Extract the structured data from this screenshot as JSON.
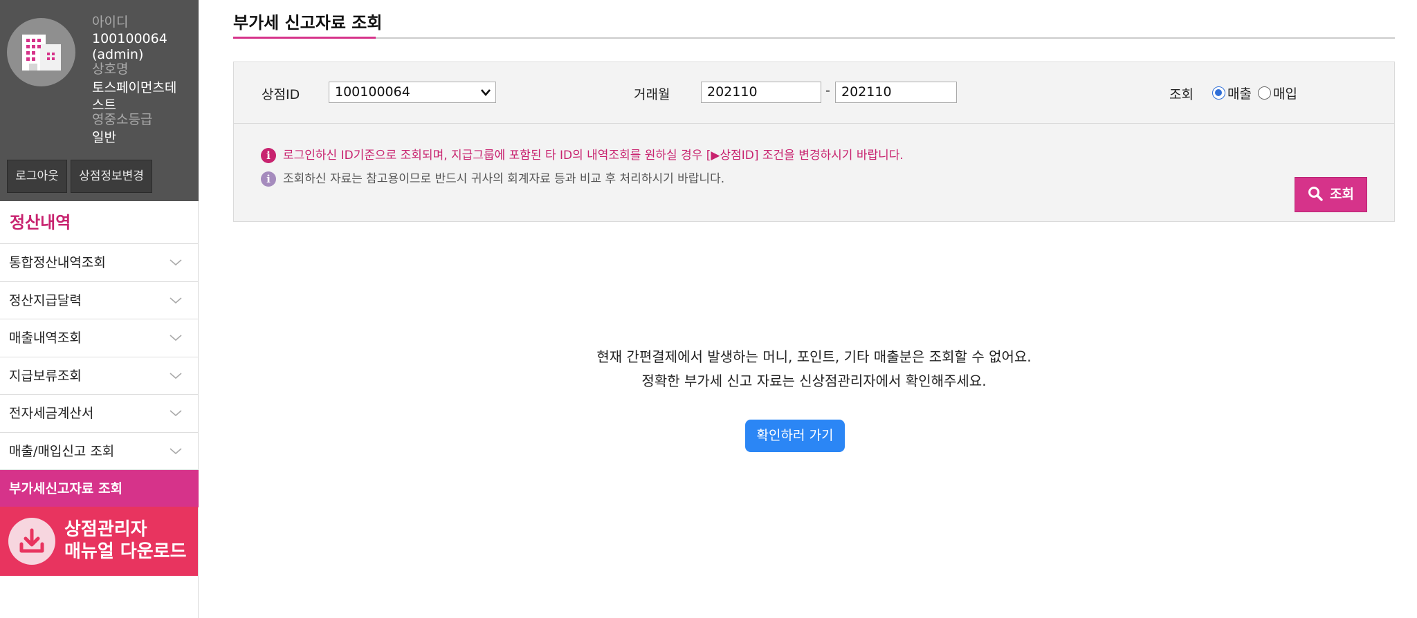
{
  "profile": {
    "id_label": "아이디",
    "id_value": "100100064",
    "id_role": "(admin)",
    "store_name_label": "상호명",
    "store_name_line1": "토스페이먼츠테",
    "store_name_line2": "스트",
    "grade_label": "영중소등급",
    "grade_value": "일반",
    "avatar_icon": "building-icon",
    "logout_label": "로그아웃",
    "edit_label": "상점정보변경"
  },
  "sidebar": {
    "section_title": "정산내역",
    "items": [
      {
        "label": "통합정산내역조회",
        "icon": "chevron-down-icon"
      },
      {
        "label": "정산지급달력",
        "icon": "chevron-down-icon"
      },
      {
        "label": "매출내역조회",
        "icon": "chevron-down-icon"
      },
      {
        "label": "지급보류조회",
        "icon": "chevron-down-icon"
      },
      {
        "label": "전자세금계산서",
        "icon": "chevron-down-icon"
      },
      {
        "label": "매출/매입신고 조회",
        "icon": "chevron-down-icon"
      },
      {
        "label": "부가세신고자료 조회",
        "active": true
      }
    ],
    "manual_banner": {
      "line1": "상점관리자",
      "line2": "매뉴얼 다운로드",
      "icon": "download-icon",
      "color": "#e8345f"
    }
  },
  "main": {
    "title": "부가세 신고자료 조회",
    "filters": {
      "store_id_label": "상점ID",
      "store_id_value": "100100064",
      "period_label": "거래월",
      "period_from": "202110",
      "period_separator": "-",
      "period_to": "202110",
      "view_label": "조회",
      "radio_options": [
        {
          "label": "매출",
          "selected": true
        },
        {
          "label": "매입",
          "selected": false
        }
      ]
    },
    "notices": [
      "로그인하신 ID기준으로 조회되며, 지급그룹에 포함된 타 ID의 내역조회를 원하실 경우 [▶상점ID] 조건을 변경하시기 바랍니다.",
      "조회하신 자료는 참고용이므로 반드시 귀사의 회계자료 등과 비교 후 처리하시기 바랍니다."
    ],
    "notice_icon": "info-icon",
    "search_button": "조회",
    "search_icon": "search-icon",
    "message_line1": "현재 간편결제에서 발생하는 머니, 포인트, 기타 매출분은 조회할 수 없어요.",
    "message_line2": "정확한 부가세 신고 자료는 신상점관리자에서 확인해주세요.",
    "go_button": "확인하러 가기"
  },
  "colors": {
    "accent": "#d6338a",
    "profile_bg": "#535353",
    "link_button": "#2b86f5"
  }
}
